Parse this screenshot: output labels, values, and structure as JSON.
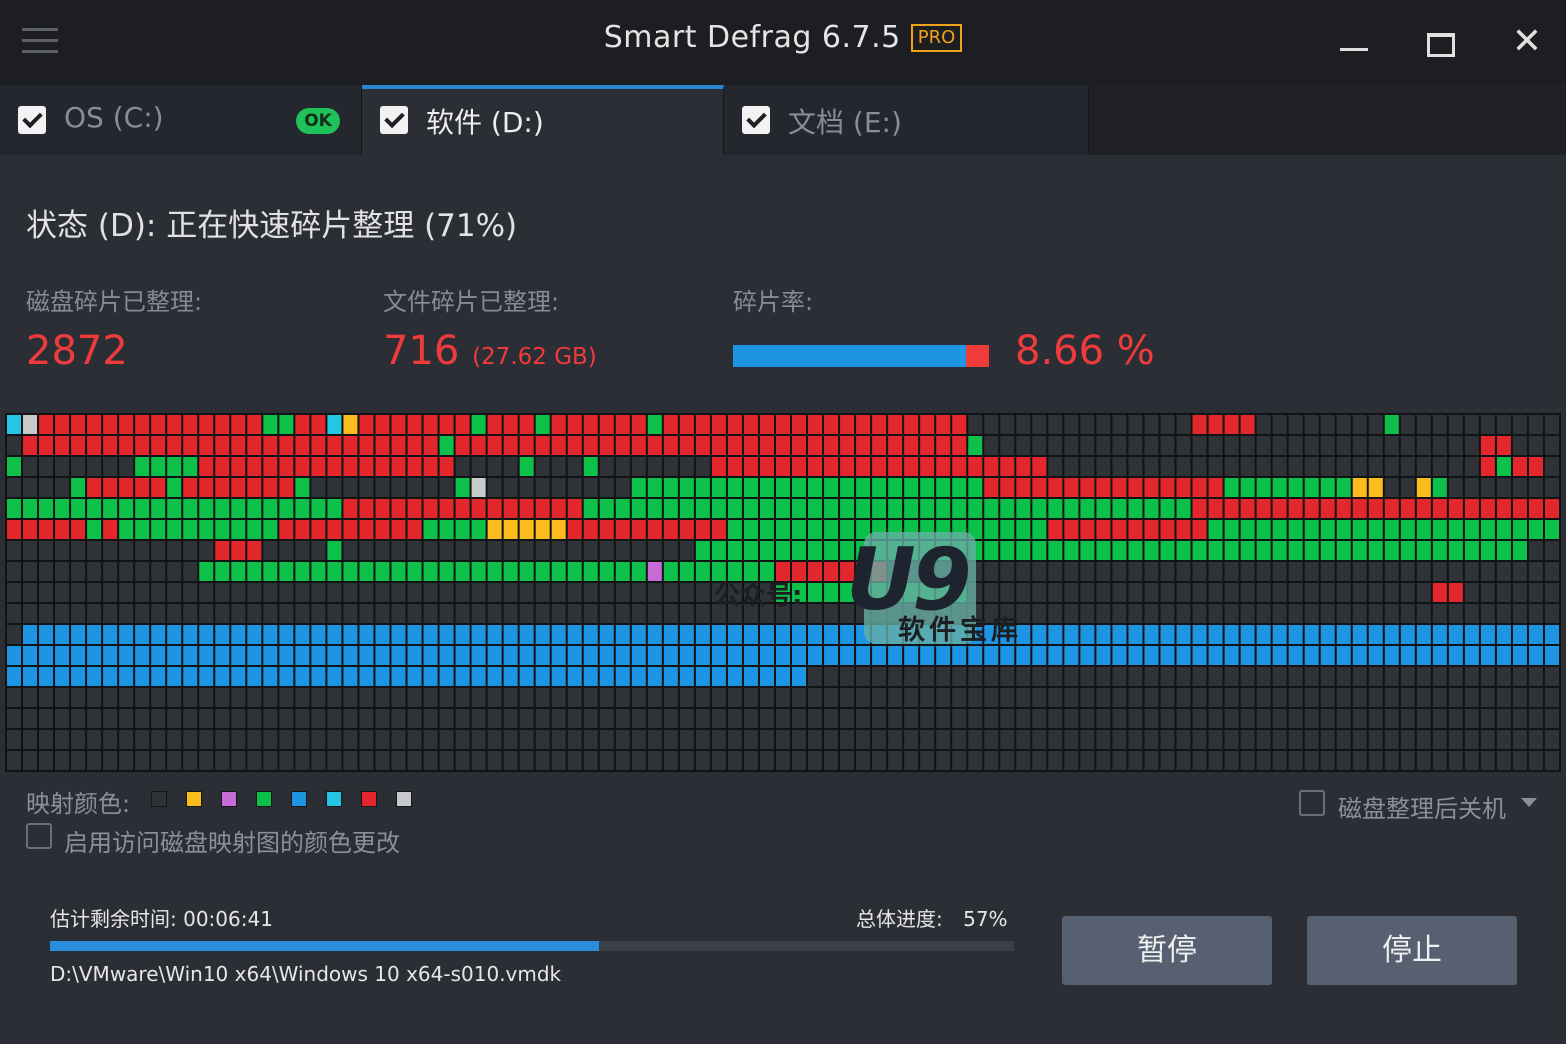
{
  "window": {
    "title": "Smart Defrag 6.7.5",
    "badge": "PRO",
    "close_glyph": "✕"
  },
  "tabs": [
    {
      "label": "OS (C:)",
      "checked": true,
      "status": "OK"
    },
    {
      "label": "软件 (D:)",
      "checked": true,
      "status": "spinner-icon"
    },
    {
      "label": "文档 (E:)",
      "checked": true,
      "status": ""
    }
  ],
  "status": {
    "text": "状态 (D): 正在快速碎片整理 (71%)"
  },
  "stats": {
    "disk_frag_label": "磁盘碎片已整理:",
    "disk_frag_value": "2872",
    "file_frag_label": "文件碎片已整理:",
    "file_frag_value": "716",
    "file_frag_size": "(27.62 GB)",
    "frag_rate_label": "碎片率:",
    "frag_rate_value": "8.66 %",
    "frag_rate_bar_fraction": 0.91
  },
  "diskmap": {
    "palette": {
      "E": "#2f3237",
      "R": "#e3272d",
      "G": "#0dc04a",
      "B": "#1e95e3",
      "Y": "#fbbc1e",
      "C": "#24c6e3",
      "S": "#c8c9cb",
      "P": "#c76bd6"
    },
    "rows": [
      "CSRRRRRRRRRRRRRRGGRRCYRRRRRRRGRRRGRRRRRRGRRRRRRRRRRRRRRRRRRREEEEEEEEEEEEEERRRREEEEEEEEGEEEEEEEEEE",
      "ERRRRRRRRRRRRRRRRRRRRRRRRRRGRRRRRRRRRRRRRRRRRRRRRRRRRRRRRRRRGEEEEEEEEEEEEEEEEEEEEEEEEEEEEEEERREEEEEEG",
      "GEEEEEEEGGGGRRRRRRRRRRRRRRRREEEEGEEEGEEEEEEERRRRRRRRRRRRRRRRRRRRREEEEEEEEEEEEEEEEEEEEEEEEEEERGRRERGE",
      "EEEEGRRRRRGRRRRRRRGEEEEEEEEEGSEEEEEEEEEGGGGGGGGGGGGGGGGGGGGGGRRRRRRRRRRRRRRRGGGGGGGGYYEEYGEEEEEEEEEE",
      "GGGGGGGGGGGGGGGGGGGGGRRRRRRRRRRRRRRRGGGGGGGGGGGGGGGGGGGGGGGGGGGGGGGGGGGGGGRRRRRRRRRRRRRRRRRRRRRRRRRR",
      "RRRRRGRGGGGGGGGGGRRRRRRRRRGGGGYYYYYRRRRRRRRRRGGGGGGGGGGGGGGGGGGGGRRRRRRRRRRGGGGGGGGGGGGGGGGGGGGGGGGGEE",
      "EEEEEEEEEEEEERRREEEEGEEEEEEEEEEEEEEEEEEEEEEGGGGGGGGGGGGGGGGGGGGGGGGGGGGGGGGGGGGGGGGGGGGGGGGGGGGEEEEEE",
      "EEEEEEEEEEEEGGGGGGGGGGGGGGGGGGGGGGGGGGGGPGGGGGGGRRRRRRREEEEEEEEEEEEEEEEEEEEEEEEEEEEEEEEEEEEEEEEEEEEEEE",
      "EEEEEEEEEEEEEEEEEEEEEEEEEEEEEEEEEEEEEEEEEEEEEEEEGGGGGGGGGGGGEEEEEEEEEEEEEEEEEEEEEEEEEEEEERREEEEEEEEEEE",
      "EEEEEEEEEEEEEEEEEEEEEEEEEEEEEEEEEEEEEEEEEEEEEEEEEEEEEEEEEEEEEEEEEEEEEEEEEEEEEEEEEEEEEEEEEEEEEEEEEEEEEE",
      "EBBBBBBBBBBBBBBBBBBBBBBBBBBBBBBBBBBBBBBBBBBBBBBBBBBBBBBBBBBBBBBBBBBBBBBBBBBBBBBBBBBBBBBBBBBBBBBBBBBBBB",
      "BBBBBBBBBBBBBBBBBBBBBBBBBBBBBBBBBBBBBBBBBBBBBBBBBBBBBBBBBBBBBBBBBBBBBBBBBBBBBBBBBBBBBBBBBBBBBBBBBBBBBB",
      "BBBBBBBBBBBBBBBBBBBBBBBBBBBBBBBBBBBBBBBBBBBBBBBBBBEEEEEEEEEEEEEEEEEEEEEEEEEEEEEEEEEEEEEEEEEEEEEEEEEEEE",
      "EEEEEEEEEEEEEEEEEEEEEEEEEEEEEEEEEEEEEEEEEEEEEEEEEEEEEEEEEEEEEEEEEEEEEEEEEEEEEEEEEEEEEEEEEEEEEEEEEEEEEE",
      "EEEEEEEEEEEEEEEEEEEEEEEEEEEEEEEEEEEEEEEEEEEEEEEEEEEEEEEEEEEEEEEEEEEEEEEEEEEEEEEEEEEEEEEEEEEEEEEEEEEEEE",
      "EEEEEEEEEEEEEEEEEEEEEEEEEEEEEEEEEEEEEEEEEEEEEEEEEEEEEEEEEEEEEEEEEEEEEEEEEEEEEEEEEEEEEEEEEEEEEEEEEEEEEE",
      "EEEEEEEEEEEEEEEEEEEEEEEEEEEEEEEEEEEEEEEEEEEEEEEEEEEEEEEEEEEEEEEEEEEEEEEEEEEEEEEEEEEEEEEEEEEEEEEEEEEEEE"
    ]
  },
  "legend": {
    "label": "映射颜色:",
    "colors": [
      "#2f3237",
      "#fbbc1e",
      "#c76bd6",
      "#0dc04a",
      "#1e95e3",
      "#24c6e3",
      "#e3272d",
      "#c8c9cb"
    ]
  },
  "options": {
    "enable_color_change_label": "启用访问磁盘映射图的颜色更改",
    "enable_color_change_checked": false,
    "shutdown_label": "磁盘整理后关机",
    "shutdown_checked": false
  },
  "progress": {
    "remaining_label": "估计剩余时间:",
    "remaining_value": "00:06:41",
    "total_label": "总体进度:",
    "total_value": "57%",
    "fraction": 0.57,
    "current_file": "D:\\VMware\\Win10 x64\\Windows 10 x64-s010.vmdk"
  },
  "buttons": {
    "pause": "暂停",
    "stop": "停止"
  },
  "watermark": {
    "prefix": "公众号:",
    "logo": "U9",
    "sub": "软件宝库"
  }
}
